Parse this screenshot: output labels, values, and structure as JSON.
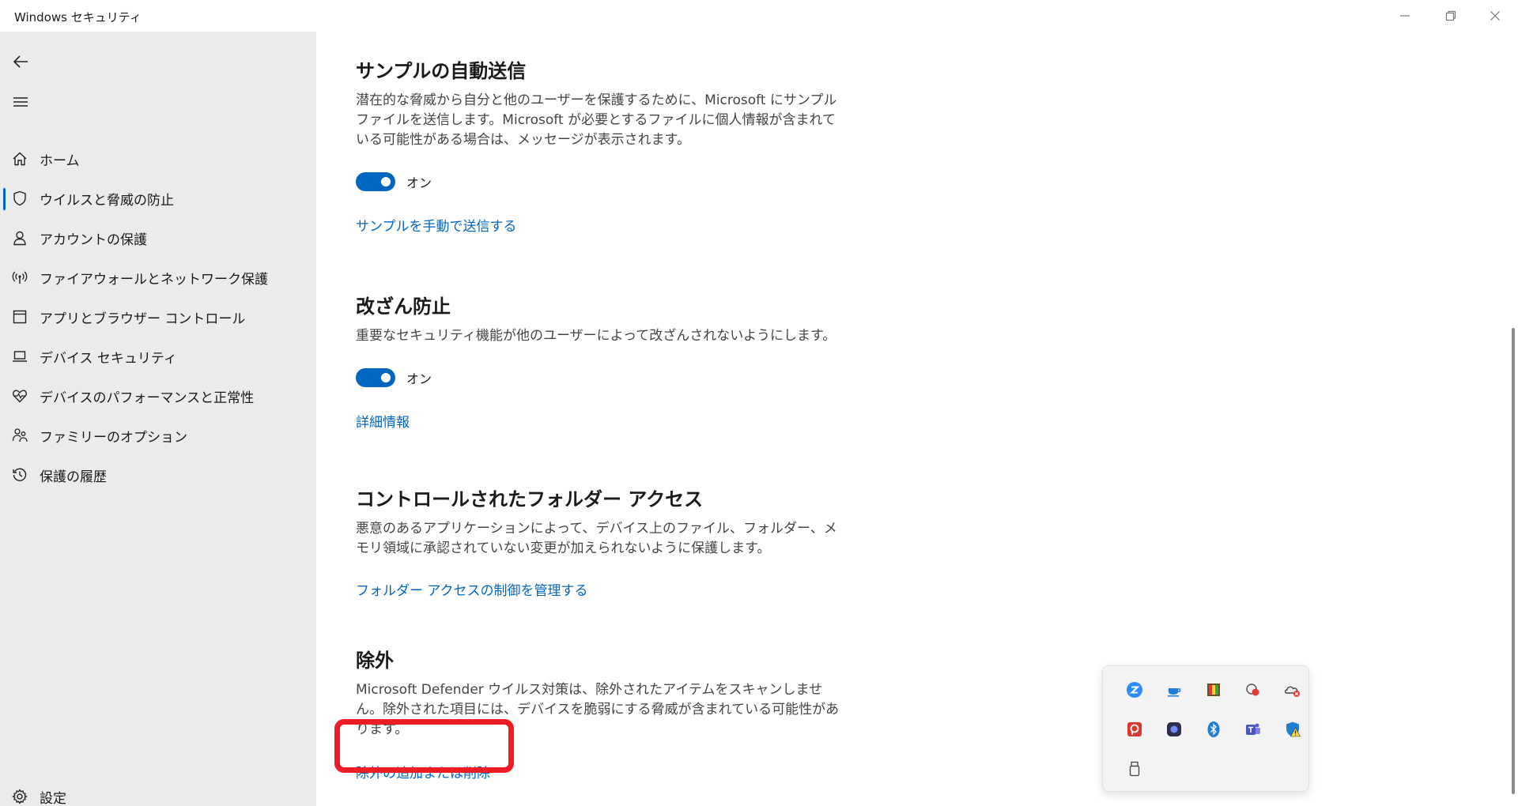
{
  "window": {
    "title": "Windows セキュリティ"
  },
  "sidebar": {
    "items": [
      {
        "label": "ホーム"
      },
      {
        "label": "ウイルスと脅威の防止"
      },
      {
        "label": "アカウントの保護"
      },
      {
        "label": "ファイアウォールとネットワーク保護"
      },
      {
        "label": "アプリとブラウザー コントロール"
      },
      {
        "label": "デバイス セキュリティ"
      },
      {
        "label": "デバイスのパフォーマンスと正常性"
      },
      {
        "label": "ファミリーのオプション"
      },
      {
        "label": "保護の履歴"
      }
    ],
    "settings_label": "設定"
  },
  "main": {
    "sample": {
      "title": "サンプルの自動送信",
      "description": "潜在的な脅威から自分と他のユーザーを保護するために、Microsoft にサンプル ファイルを送信します。Microsoft が必要とするファイルに個人情報が含まれている可能性がある場合は、メッセージが表示されます。",
      "toggle_label": "オン",
      "link": "サンプルを手動で送信する"
    },
    "tamper": {
      "title": "改ざん防止",
      "description": "重要なセキュリティ機能が他のユーザーによって改ざんされないようにします。",
      "toggle_label": "オン",
      "link": "詳細情報"
    },
    "folder": {
      "title": "コントロールされたフォルダー アクセス",
      "description": "悪意のあるアプリケーションによって、デバイス上のファイル、フォルダー、メモリ領域に承認されていない変更が加えられないように保護します。",
      "link": "フォルダー アクセスの制御を管理する"
    },
    "exclusion": {
      "title": "除外",
      "description": "Microsoft Defender ウイルス対策は、除外されたアイテムをスキャンしません。除外された項目には、デバイスを脆弱にする脅威が含まれている可能性があります。",
      "link": "除外の追加または削除"
    }
  },
  "tray": {
    "icons": [
      "zoom-icon",
      "coffee-icon",
      "palette-icon",
      "camera-record-icon",
      "onedrive-error-icon",
      "powerpoint-icon",
      "app-icon",
      "bluetooth-icon",
      "teams-icon",
      "defender-warning-icon",
      "usb-icon"
    ]
  },
  "colors": {
    "accent": "#0067c0",
    "highlight": "#ee1c25",
    "sidebar_bg": "#ebebeb"
  }
}
